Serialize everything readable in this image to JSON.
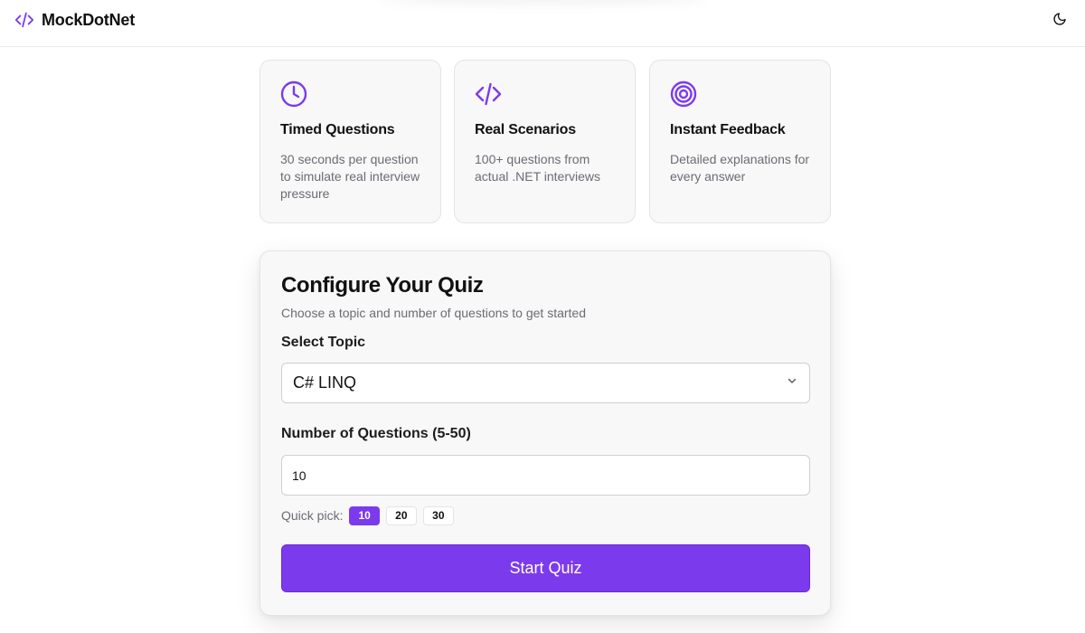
{
  "app": {
    "brand_name": "MockDotNet",
    "accent_color": "#7c3aed",
    "brand_icon": "code-icon",
    "theme_toggle_icon": "moon-icon"
  },
  "features": [
    {
      "icon": "clock-icon",
      "title": "Timed Questions",
      "description": "30 seconds per question to simulate real interview pressure"
    },
    {
      "icon": "code-icon",
      "title": "Real Scenarios",
      "description": "100+ questions from actual .NET interviews"
    },
    {
      "icon": "target-icon",
      "title": "Instant Feedback",
      "description": "Detailed explanations for every answer"
    }
  ],
  "config": {
    "title": "Configure Your Quiz",
    "subtitle": "Choose a topic and number of questions to get started",
    "topic_label": "Select Topic",
    "topic_selected": "C# LINQ",
    "count_label": "Number of Questions (5-50)",
    "count_value": "10",
    "quick_pick_label": "Quick pick:",
    "quick_picks": [
      {
        "label": "10",
        "active": true
      },
      {
        "label": "20",
        "active": false
      },
      {
        "label": "30",
        "active": false
      }
    ],
    "start_label": "Start Quiz"
  }
}
